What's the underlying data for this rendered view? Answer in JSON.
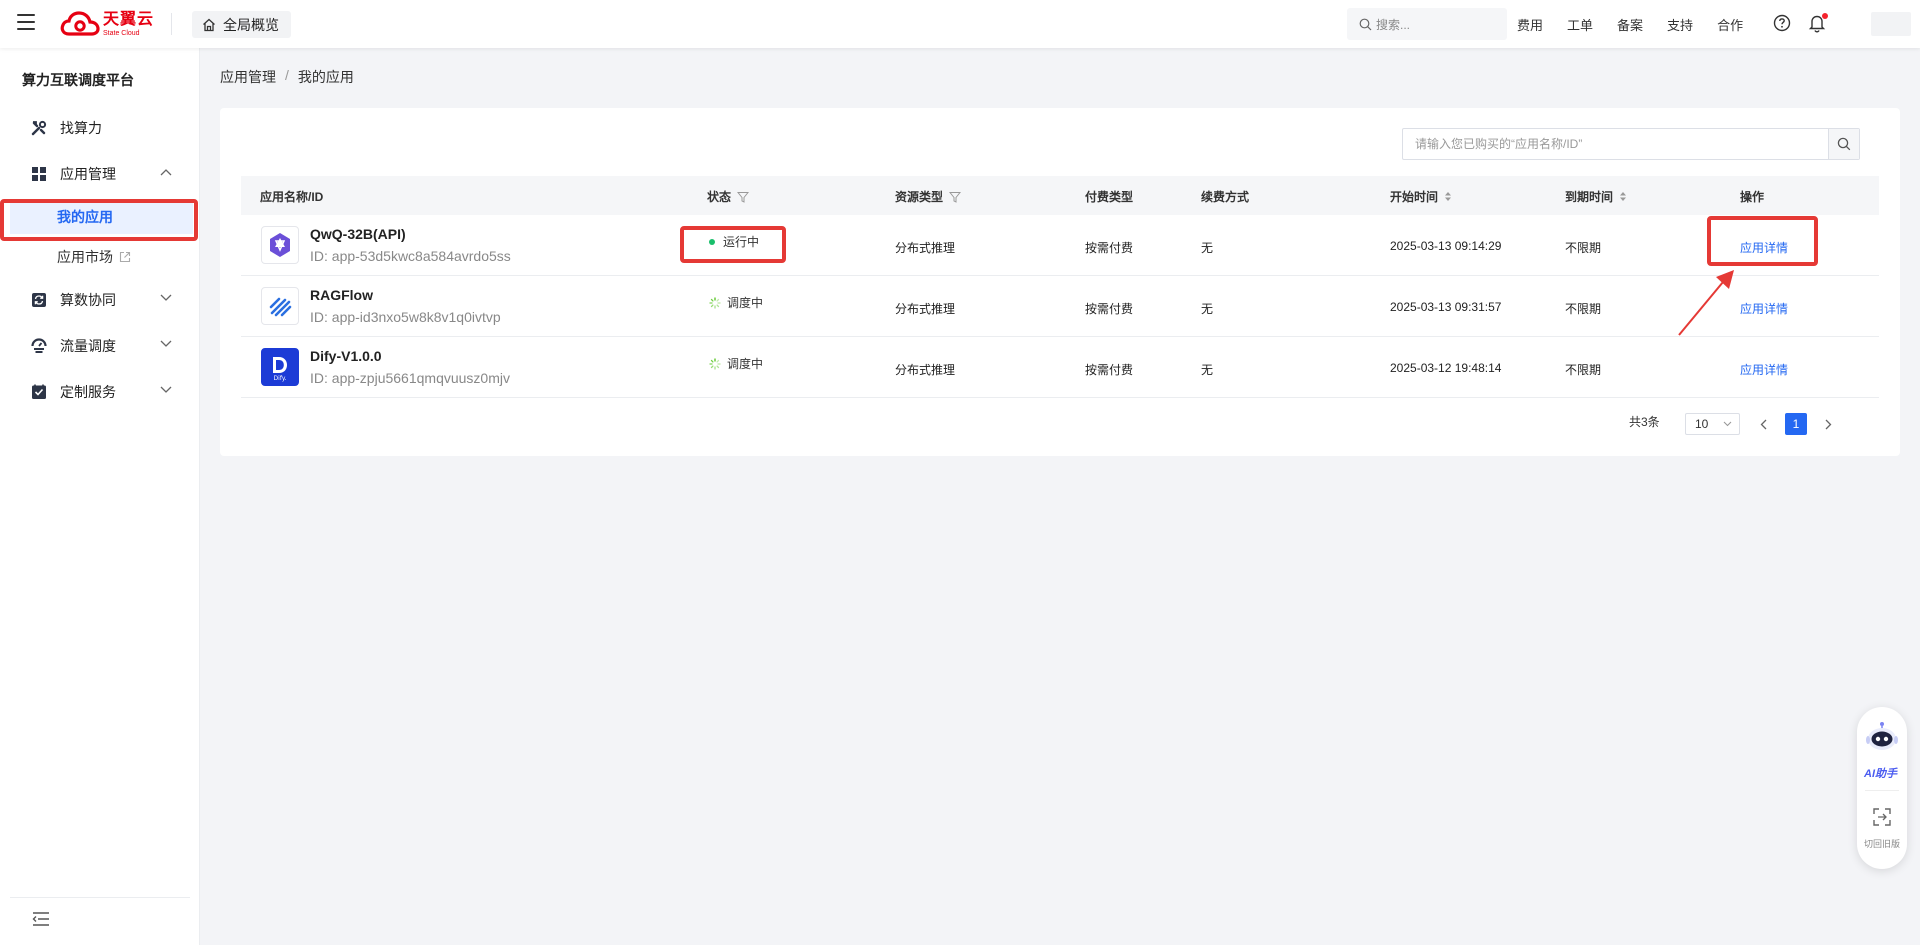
{
  "header": {
    "logo_cn": "天翼云",
    "logo_en": "State Cloud",
    "home_tab": "全局概览",
    "search_placeholder": "搜索...",
    "links": [
      "费用",
      "工单",
      "备案",
      "支持",
      "合作"
    ]
  },
  "sidebar": {
    "title": "算力互联调度平台",
    "items": [
      {
        "label": "找算力"
      },
      {
        "label": "应用管理",
        "expanded": true,
        "children": [
          {
            "label": "我的应用",
            "active": true
          },
          {
            "label": "应用市场"
          }
        ]
      },
      {
        "label": "算数协同"
      },
      {
        "label": "流量调度"
      },
      {
        "label": "定制服务"
      }
    ]
  },
  "breadcrumb": [
    "应用管理",
    "我的应用"
  ],
  "main": {
    "search_placeholder": "请输入您已购买的“应用名称/ID”",
    "columns": [
      "应用名称/ID",
      "状态",
      "资源类型",
      "付费类型",
      "续费方式",
      "开始时间",
      "到期时间",
      "操作"
    ],
    "rows": [
      {
        "name": "QwQ-32B(API)",
        "id": "ID: app-53d5kwc8a584avrdo5ss",
        "status": "运行中",
        "resource": "分布式推理",
        "pay": "按需付费",
        "renew": "无",
        "start": "2025-03-13 09:14:29",
        "end": "不限期",
        "action": "应用详情"
      },
      {
        "name": "RAGFlow",
        "id": "ID: app-id3nxo5w8k8v1q0ivtvp",
        "status": "调度中",
        "resource": "分布式推理",
        "pay": "按需付费",
        "renew": "无",
        "start": "2025-03-13 09:31:57",
        "end": "不限期",
        "action": "应用详情"
      },
      {
        "name": "Dify-V1.0.0",
        "id": "ID: app-zpju5661qmqvuusz0mjv",
        "status": "调度中",
        "resource": "分布式推理",
        "pay": "按需付费",
        "renew": "无",
        "start": "2025-03-12 19:48:14",
        "end": "不限期",
        "action": "应用详情"
      }
    ],
    "pagination": {
      "total": "共3条",
      "page_size": "10",
      "current_page": "1"
    }
  },
  "assistant": {
    "ai_label": "AI助手",
    "switch_label": "切回旧版"
  },
  "colors": {
    "primary": "#2468f2",
    "brand_red": "#e60012",
    "running_green": "#19be6b",
    "annotation_red": "#e53935"
  }
}
